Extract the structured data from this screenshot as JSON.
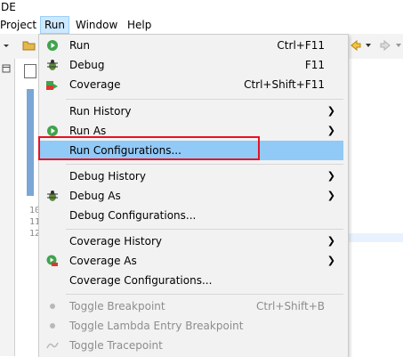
{
  "app": {
    "title": "DE"
  },
  "menubar": {
    "items": [
      {
        "label": "Project"
      },
      {
        "label": "Run"
      },
      {
        "label": "Window"
      },
      {
        "label": "Help"
      }
    ]
  },
  "editor": {
    "line_numbers": [
      "10",
      "11",
      "12"
    ]
  },
  "run_menu": {
    "items": [
      {
        "label": "Run",
        "accel": "Ctrl+F11",
        "icon": "run-icon"
      },
      {
        "label": "Debug",
        "accel": "F11",
        "icon": "debug-icon"
      },
      {
        "label": "Coverage",
        "accel": "Ctrl+Shift+F11",
        "icon": "coverage-icon"
      },
      {
        "label": "Run History",
        "accel": "",
        "submenu": true
      },
      {
        "label": "Run As",
        "accel": "",
        "submenu": true,
        "icon": "run-icon"
      },
      {
        "label": "Run Configurations...",
        "accel": "",
        "highlighted": true
      },
      {
        "label": "Debug History",
        "accel": "",
        "submenu": true
      },
      {
        "label": "Debug As",
        "accel": "",
        "submenu": true,
        "icon": "debug-icon"
      },
      {
        "label": "Debug Configurations...",
        "accel": ""
      },
      {
        "label": "Coverage History",
        "accel": "",
        "submenu": true
      },
      {
        "label": "Coverage As",
        "accel": "",
        "submenu": true,
        "icon": "coverage-icon"
      },
      {
        "label": "Coverage Configurations...",
        "accel": ""
      },
      {
        "label": "Toggle Breakpoint",
        "accel": "Ctrl+Shift+B",
        "disabled": true,
        "icon": "bullet-icon"
      },
      {
        "label": "Toggle Lambda Entry Breakpoint",
        "accel": "",
        "disabled": true,
        "icon": "bullet-icon"
      },
      {
        "label": "Toggle Tracepoint",
        "accel": "",
        "disabled": true,
        "icon": "tracepoint-icon"
      }
    ]
  },
  "colors": {
    "highlight": "#91c9f7",
    "annotation_box": "#e81123",
    "menu_bg": "#f2f2f2"
  }
}
